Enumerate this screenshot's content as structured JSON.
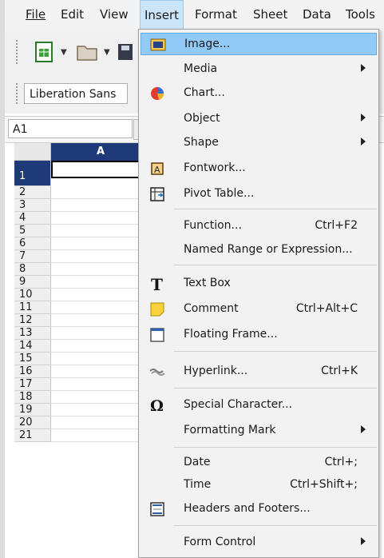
{
  "menubar": {
    "items": [
      {
        "label": "File"
      },
      {
        "label": "Edit"
      },
      {
        "label": "View"
      },
      {
        "label": "Insert"
      },
      {
        "label": "Format"
      },
      {
        "label": "Sheet"
      },
      {
        "label": "Data"
      },
      {
        "label": "Tools"
      }
    ]
  },
  "toolbar": {
    "font_name": "Liberation Sans"
  },
  "formula": {
    "cell_ref": "A1"
  },
  "sheet": {
    "column": "A",
    "rows": [
      "1",
      "2",
      "3",
      "4",
      "5",
      "6",
      "7",
      "8",
      "9",
      "10",
      "11",
      "12",
      "13",
      "14",
      "15",
      "16",
      "17",
      "18",
      "19",
      "20",
      "21"
    ]
  },
  "insert_menu": {
    "items": [
      {
        "label": "Image...",
        "shortcut": "",
        "icon": "image-icon"
      },
      {
        "label": "Media",
        "shortcut": "",
        "icon": ""
      },
      {
        "label": "Chart...",
        "shortcut": "",
        "icon": "chart-pie-icon"
      },
      {
        "label": "Object",
        "shortcut": "",
        "icon": ""
      },
      {
        "label": "Shape",
        "shortcut": "",
        "icon": ""
      },
      {
        "label": "Fontwork...",
        "shortcut": "",
        "icon": "fontwork-icon"
      },
      {
        "label": "Pivot Table...",
        "shortcut": "",
        "icon": "pivot-table-icon"
      },
      {
        "label": "Function...",
        "shortcut": "Ctrl+F2",
        "icon": ""
      },
      {
        "label": "Named Range or Expression...",
        "shortcut": "",
        "icon": ""
      },
      {
        "label": "Text Box",
        "shortcut": "",
        "icon": "text-box-icon"
      },
      {
        "label": "Comment",
        "shortcut": "Ctrl+Alt+C",
        "icon": "comment-icon"
      },
      {
        "label": "Floating Frame...",
        "shortcut": "",
        "icon": "floating-frame-icon"
      },
      {
        "label": "Hyperlink...",
        "shortcut": "Ctrl+K",
        "icon": "hyperlink-icon"
      },
      {
        "label": "Special Character...",
        "shortcut": "",
        "icon": "omega-icon"
      },
      {
        "label": "Formatting Mark",
        "shortcut": "",
        "icon": ""
      },
      {
        "label": "Date",
        "shortcut": "Ctrl+;",
        "icon": ""
      },
      {
        "label": "Time",
        "shortcut": "Ctrl+Shift+;",
        "icon": ""
      },
      {
        "label": "Headers and Footers...",
        "shortcut": "",
        "icon": "headers-footers-icon"
      },
      {
        "label": "Form Control",
        "shortcut": "",
        "icon": ""
      }
    ]
  },
  "colors": {
    "highlight": "#91c9f7",
    "selected_header": "#1f3a78"
  }
}
